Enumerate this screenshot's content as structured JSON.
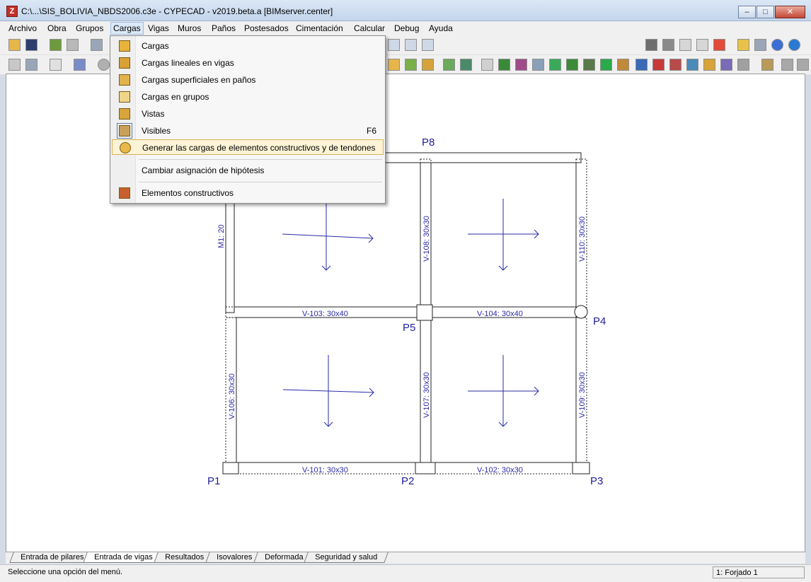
{
  "window": {
    "title": "C:\\...\\SIS_BOLIVIA_NBDS2006.c3e - CYPECAD - v2019.beta.a [BIMserver.center]",
    "app_icon_text": "Z",
    "minimize_glyph": "–",
    "maximize_glyph": "□",
    "close_glyph": "✕"
  },
  "menubar": {
    "items": [
      "Archivo",
      "Obra",
      "Grupos",
      "Cargas",
      "Vigas",
      "Muros",
      "Paños",
      "Postesados",
      "Cimentación",
      "Calcular",
      "Debug",
      "Ayuda"
    ],
    "active": "Cargas"
  },
  "cargas_menu": {
    "items": [
      {
        "label": "Cargas",
        "icon": "load-arrow-icon"
      },
      {
        "label": "Cargas lineales en vigas",
        "icon": "beam-linear-load-icon"
      },
      {
        "label": "Cargas superficiales en paños",
        "icon": "surface-load-icon"
      },
      {
        "label": "Cargas en grupos",
        "icon": "group-load-icon"
      },
      {
        "label": "Vistas",
        "icon": "views-icon"
      },
      {
        "label": "Visibles",
        "icon": "visible-icon",
        "shortcut": "F6",
        "checked": true
      },
      {
        "label": "Generar las cargas de elementos constructivos y de tendones",
        "icon": "generate-loads-icon",
        "highlighted": true
      },
      {
        "label": "Cambiar asignación de hipótesis",
        "icon": "none"
      },
      {
        "label": "Elementos constructivos",
        "icon": "brick-wall-icon"
      }
    ]
  },
  "colors": {
    "drawing_blue": "#2a2aa6",
    "structure_black": "#222222",
    "menu_highlight": "#fdf3d6",
    "menu_highlight_border": "#d8b35a"
  },
  "drawing": {
    "pillars": [
      {
        "name": "P1"
      },
      {
        "name": "P2"
      },
      {
        "name": "P3"
      },
      {
        "name": "P4"
      },
      {
        "name": "P5"
      },
      {
        "name": "P8"
      }
    ],
    "beams": [
      {
        "name": "V-101: 30x30"
      },
      {
        "name": "V-102: 30x30"
      },
      {
        "name": "V-103: 30x40"
      },
      {
        "name": "V-104: 30x40"
      },
      {
        "name": "V-106: 30x30"
      },
      {
        "name": "V-107: 30x30"
      },
      {
        "name": "V-108: 30x30"
      },
      {
        "name": "V-109: 30x30"
      },
      {
        "name": "V-110: 30x30"
      }
    ],
    "wall": {
      "name": "M1: 20"
    }
  },
  "tabs": {
    "items": [
      "Entrada de pilares",
      "Entrada de vigas",
      "Resultados",
      "Isovalores",
      "Deformada",
      "Seguridad y salud"
    ],
    "active": "Entrada de vigas"
  },
  "status": {
    "message": "Seleccione una opción del menú.",
    "floor": "1: Forjado 1"
  }
}
